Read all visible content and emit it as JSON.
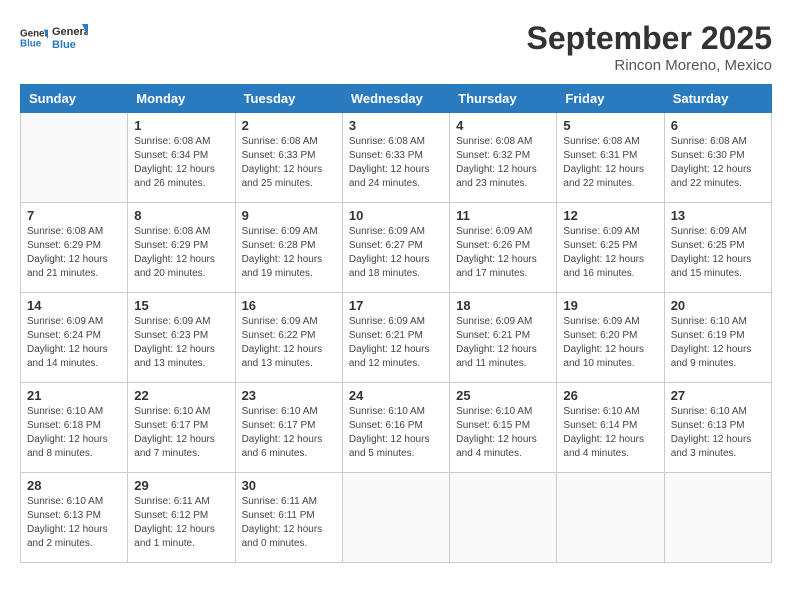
{
  "header": {
    "logo_general": "General",
    "logo_blue": "Blue",
    "month_title": "September 2025",
    "location": "Rincon Moreno, Mexico"
  },
  "weekdays": [
    "Sunday",
    "Monday",
    "Tuesday",
    "Wednesday",
    "Thursday",
    "Friday",
    "Saturday"
  ],
  "weeks": [
    [
      {
        "day": "",
        "info": ""
      },
      {
        "day": "1",
        "info": "Sunrise: 6:08 AM\nSunset: 6:34 PM\nDaylight: 12 hours\nand 26 minutes."
      },
      {
        "day": "2",
        "info": "Sunrise: 6:08 AM\nSunset: 6:33 PM\nDaylight: 12 hours\nand 25 minutes."
      },
      {
        "day": "3",
        "info": "Sunrise: 6:08 AM\nSunset: 6:33 PM\nDaylight: 12 hours\nand 24 minutes."
      },
      {
        "day": "4",
        "info": "Sunrise: 6:08 AM\nSunset: 6:32 PM\nDaylight: 12 hours\nand 23 minutes."
      },
      {
        "day": "5",
        "info": "Sunrise: 6:08 AM\nSunset: 6:31 PM\nDaylight: 12 hours\nand 22 minutes."
      },
      {
        "day": "6",
        "info": "Sunrise: 6:08 AM\nSunset: 6:30 PM\nDaylight: 12 hours\nand 22 minutes."
      }
    ],
    [
      {
        "day": "7",
        "info": "Sunrise: 6:08 AM\nSunset: 6:29 PM\nDaylight: 12 hours\nand 21 minutes."
      },
      {
        "day": "8",
        "info": "Sunrise: 6:08 AM\nSunset: 6:29 PM\nDaylight: 12 hours\nand 20 minutes."
      },
      {
        "day": "9",
        "info": "Sunrise: 6:09 AM\nSunset: 6:28 PM\nDaylight: 12 hours\nand 19 minutes."
      },
      {
        "day": "10",
        "info": "Sunrise: 6:09 AM\nSunset: 6:27 PM\nDaylight: 12 hours\nand 18 minutes."
      },
      {
        "day": "11",
        "info": "Sunrise: 6:09 AM\nSunset: 6:26 PM\nDaylight: 12 hours\nand 17 minutes."
      },
      {
        "day": "12",
        "info": "Sunrise: 6:09 AM\nSunset: 6:25 PM\nDaylight: 12 hours\nand 16 minutes."
      },
      {
        "day": "13",
        "info": "Sunrise: 6:09 AM\nSunset: 6:25 PM\nDaylight: 12 hours\nand 15 minutes."
      }
    ],
    [
      {
        "day": "14",
        "info": "Sunrise: 6:09 AM\nSunset: 6:24 PM\nDaylight: 12 hours\nand 14 minutes."
      },
      {
        "day": "15",
        "info": "Sunrise: 6:09 AM\nSunset: 6:23 PM\nDaylight: 12 hours\nand 13 minutes."
      },
      {
        "day": "16",
        "info": "Sunrise: 6:09 AM\nSunset: 6:22 PM\nDaylight: 12 hours\nand 13 minutes."
      },
      {
        "day": "17",
        "info": "Sunrise: 6:09 AM\nSunset: 6:21 PM\nDaylight: 12 hours\nand 12 minutes."
      },
      {
        "day": "18",
        "info": "Sunrise: 6:09 AM\nSunset: 6:21 PM\nDaylight: 12 hours\nand 11 minutes."
      },
      {
        "day": "19",
        "info": "Sunrise: 6:09 AM\nSunset: 6:20 PM\nDaylight: 12 hours\nand 10 minutes."
      },
      {
        "day": "20",
        "info": "Sunrise: 6:10 AM\nSunset: 6:19 PM\nDaylight: 12 hours\nand 9 minutes."
      }
    ],
    [
      {
        "day": "21",
        "info": "Sunrise: 6:10 AM\nSunset: 6:18 PM\nDaylight: 12 hours\nand 8 minutes."
      },
      {
        "day": "22",
        "info": "Sunrise: 6:10 AM\nSunset: 6:17 PM\nDaylight: 12 hours\nand 7 minutes."
      },
      {
        "day": "23",
        "info": "Sunrise: 6:10 AM\nSunset: 6:17 PM\nDaylight: 12 hours\nand 6 minutes."
      },
      {
        "day": "24",
        "info": "Sunrise: 6:10 AM\nSunset: 6:16 PM\nDaylight: 12 hours\nand 5 minutes."
      },
      {
        "day": "25",
        "info": "Sunrise: 6:10 AM\nSunset: 6:15 PM\nDaylight: 12 hours\nand 4 minutes."
      },
      {
        "day": "26",
        "info": "Sunrise: 6:10 AM\nSunset: 6:14 PM\nDaylight: 12 hours\nand 4 minutes."
      },
      {
        "day": "27",
        "info": "Sunrise: 6:10 AM\nSunset: 6:13 PM\nDaylight: 12 hours\nand 3 minutes."
      }
    ],
    [
      {
        "day": "28",
        "info": "Sunrise: 6:10 AM\nSunset: 6:13 PM\nDaylight: 12 hours\nand 2 minutes."
      },
      {
        "day": "29",
        "info": "Sunrise: 6:11 AM\nSunset: 6:12 PM\nDaylight: 12 hours\nand 1 minute."
      },
      {
        "day": "30",
        "info": "Sunrise: 6:11 AM\nSunset: 6:11 PM\nDaylight: 12 hours\nand 0 minutes."
      },
      {
        "day": "",
        "info": ""
      },
      {
        "day": "",
        "info": ""
      },
      {
        "day": "",
        "info": ""
      },
      {
        "day": "",
        "info": ""
      }
    ]
  ]
}
